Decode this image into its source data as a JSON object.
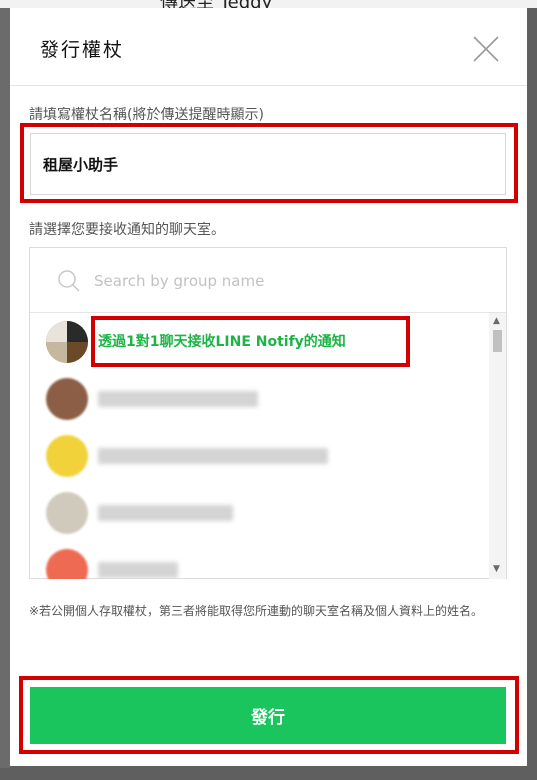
{
  "background": {
    "top_text": "傳送至 Teddy"
  },
  "modal": {
    "title": "發行權杖"
  },
  "token_name": {
    "label": "請填寫權杖名稱(將於傳送提醒時顯示)",
    "value": "租屋小助手"
  },
  "chat_select": {
    "label": "請選擇您要接收通知的聊天室。",
    "search_placeholder": "Search by group name",
    "items": [
      {
        "label": "透過1對1聊天接收LINE Notify的通知",
        "avatar": "user-avatar"
      },
      {
        "label": "",
        "avatar": "blurred-avatar"
      },
      {
        "label": "",
        "avatar": "blurred-avatar"
      },
      {
        "label": "",
        "avatar": "blurred-avatar"
      },
      {
        "label": "",
        "avatar": "blurred-avatar"
      }
    ]
  },
  "note": "※若公開個人存取權杖，第三者將能取得您所連動的聊天室名稱及個人資料上的姓名。",
  "issue_button": "發行",
  "colors": {
    "accent_green": "#1ac55e",
    "highlight_red": "#d20000"
  }
}
